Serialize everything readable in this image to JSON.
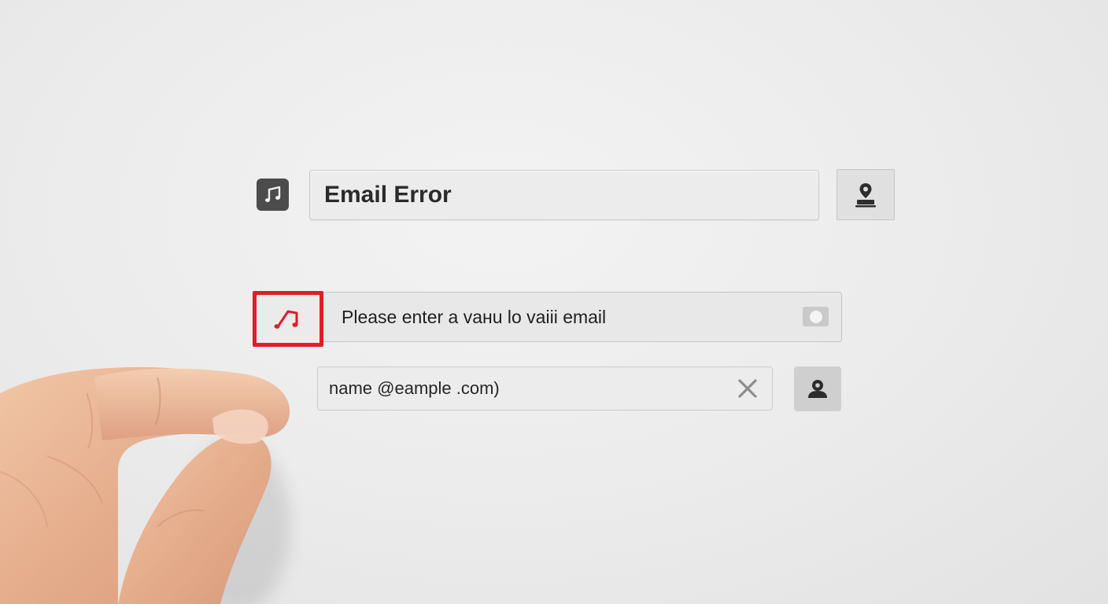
{
  "header": {
    "title_value": "Email Error",
    "app_icon": "music-note-icon",
    "action_icon": "stamp-icon"
  },
  "error": {
    "message": "Please enter a vaнu lo vaiii email",
    "icon": "music-note-icon",
    "toggle_icon": "toggle-icon",
    "accent_color": "#e01e26"
  },
  "email": {
    "value": "name @eample .com)",
    "clear_icon": "close-icon",
    "profile_icon": "user-icon"
  }
}
